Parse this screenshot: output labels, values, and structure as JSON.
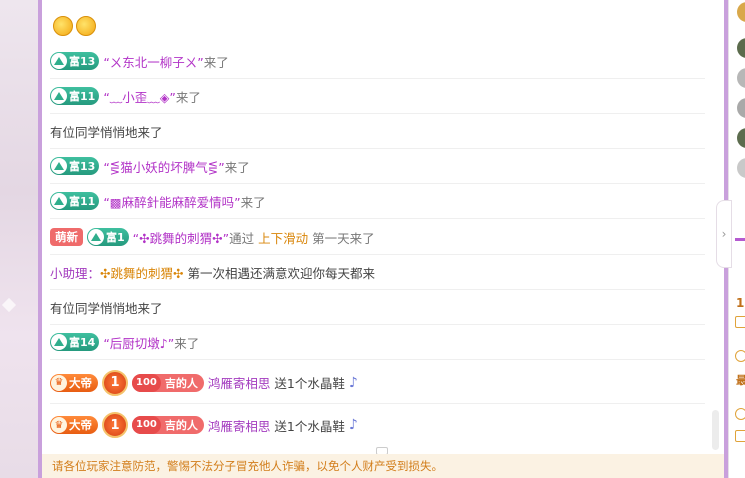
{
  "rows": [
    {
      "rich": "富13",
      "name": "“ㄨ东北一柳子ㄨ”",
      "suffix": "来了"
    },
    {
      "rich": "富11",
      "name": "“﹏小歪﹏◈”",
      "suffix": "来了"
    },
    {
      "text": "有位同学悄悄地来了"
    },
    {
      "rich": "富13",
      "name": "“⋚猫小妖的坏脾气⋚”",
      "suffix": "来了"
    },
    {
      "rich": "富11",
      "name": "“▩麻醉針能麻醉爱情吗”",
      "suffix": "来了"
    },
    {
      "new_badge": "萌新",
      "rich": "富1",
      "name": "“✣跳舞的刺猬✣”",
      "mid": "通过",
      "channel": "上下滑动",
      "suffix": "第一天来了"
    },
    {
      "assistant": "小助理：",
      "name": "✣跳舞的刺猬✣",
      "text": " 第一次相遇还满意欢迎你每天都来"
    },
    {
      "text": "有位同学悄悄地来了"
    },
    {
      "rich": "富14",
      "name": "“后厨切墩♪”",
      "suffix": "来了"
    },
    {
      "emperor": "大帝",
      "level": "1",
      "fan_num": "100",
      "fan_name": "吉的人",
      "name": "鸿雁寄相思",
      "gift": "送1个水晶鞋"
    },
    {
      "emperor": "大帝",
      "level": "1",
      "fan_num": "100",
      "fan_name": "吉的人",
      "name": "鸿雁寄相思",
      "gift": "送1个水晶鞋"
    }
  ],
  "tip": "请各位玩家注意防范，警惕不法分子冒充他人诈骗，以免个人财产受到损失。",
  "right_panel": {
    "texts": [
      "1",
      "最"
    ]
  }
}
